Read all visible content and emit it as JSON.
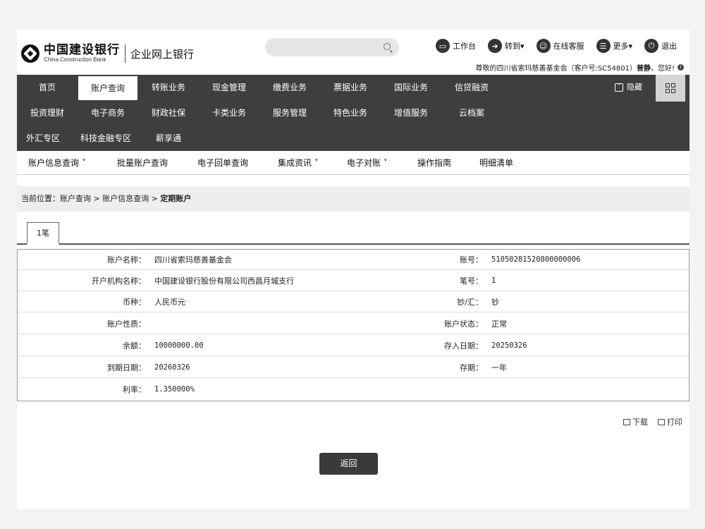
{
  "header": {
    "bank_name_cn": "中国建设银行",
    "bank_name_en": "China Construction Bank",
    "subtitle": "企业网上银行",
    "tools": [
      {
        "icon": "monitor-icon",
        "label": "工作台"
      },
      {
        "icon": "transfer-icon",
        "label": "转到▾"
      },
      {
        "icon": "customer-service-icon",
        "label": "在线客服"
      },
      {
        "icon": "more-icon",
        "label": "更多▾"
      },
      {
        "icon": "power-icon",
        "label": "退出"
      }
    ],
    "greeting_prefix": "尊敬的四川省索玛慈善基金会（客户号:SC54801）",
    "greeting_name": "普静",
    "greeting_suffix": "，您好!"
  },
  "nav": {
    "row1": [
      "首页",
      "账户查询",
      "转账业务",
      "现金管理",
      "缴费业务",
      "票据业务",
      "国际业务",
      "信贷融资"
    ],
    "row2": [
      "投资理财",
      "电子商务",
      "财政社保",
      "卡类业务",
      "服务管理",
      "特色业务",
      "增值服务",
      "云档案"
    ],
    "row3": [
      "外汇专区",
      "科技金融专区",
      "薪享通"
    ],
    "active": "账户查询",
    "hide_label": "隐藏"
  },
  "subnav": [
    "账户信息查询 ˅",
    "批量账户查询",
    "电子回单查询",
    "集成资讯 ˅",
    "电子对账 ˅",
    "操作指南",
    "明细清单"
  ],
  "breadcrumb": {
    "prefix": "当前位置：账户查询 > 账户信息查询 > ",
    "current": "定期账户"
  },
  "tab": {
    "label": "1笔"
  },
  "details": {
    "account_name_label": "账户名称：",
    "account_name": "四川省索玛慈善基金会",
    "account_no_label": "账号：",
    "account_no": "51050281520800000006",
    "branch_label": "开户机构名称：",
    "branch": "中国建设银行股份有限公司西昌月城支行",
    "seq_label": "笔号：",
    "seq": "1",
    "currency_label": "币种：",
    "currency": "人民币元",
    "cash_label": "钞/汇：",
    "cash": "钞",
    "nature_label": "账户性质：",
    "nature": "",
    "status_label": "账户状态：",
    "status": "正常",
    "balance_label": "余额：",
    "balance": "10000000.00",
    "deposit_date_label": "存入日期：",
    "deposit_date": "20250326",
    "maturity_label": "到期日期：",
    "maturity": "20260326",
    "term_label": "存期：",
    "term": "一年",
    "rate_label": "利率：",
    "rate": "1.350000%"
  },
  "actions": {
    "download": "下载",
    "print": "打印"
  },
  "back_label": "返回"
}
